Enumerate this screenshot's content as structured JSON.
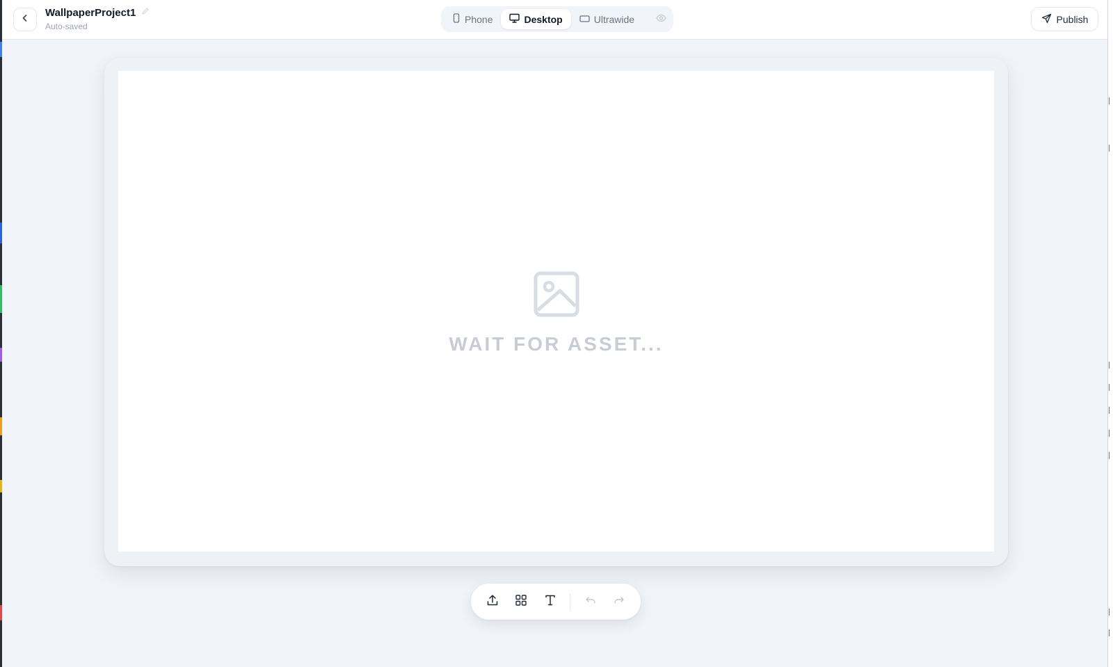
{
  "app": {
    "project_title": "WallpaperProject1",
    "save_status": "Auto-saved"
  },
  "device_toggle": {
    "items": [
      {
        "label": "Phone",
        "icon": "phone-icon",
        "active": false
      },
      {
        "label": "Desktop",
        "icon": "monitor-icon",
        "active": true
      },
      {
        "label": "Ultrawide",
        "icon": "ultrawide-icon",
        "active": false
      }
    ],
    "preview_icon": "eye-icon"
  },
  "header": {
    "publish_label": "Publish"
  },
  "canvas": {
    "placeholder_text": "WAIT FOR ASSET...",
    "placeholder_icon": "image-icon"
  },
  "toolbar": {
    "tools": [
      "upload-icon",
      "grid-icon",
      "text-icon",
      "undo-icon",
      "redo-icon"
    ]
  },
  "colors": {
    "page_bg": "#f1f4f8",
    "placeholder": "#c8ccd4",
    "text_primary": "#111827",
    "text_muted": "#9ca3af"
  }
}
